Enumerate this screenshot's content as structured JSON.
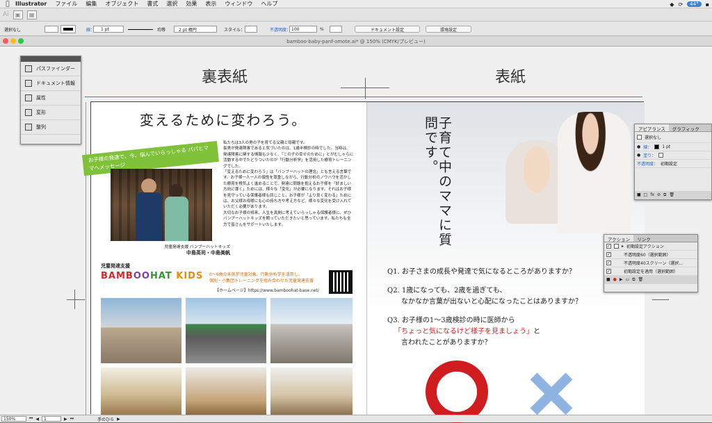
{
  "menubar": {
    "app": "Illustrator",
    "items": [
      "ファイル",
      "編集",
      "オブジェクト",
      "書式",
      "選択",
      "効果",
      "表示",
      "ウィンドウ",
      "ヘルプ"
    ],
    "battery": "44°"
  },
  "control": {
    "selection": "選択なし",
    "stroke_label": "線：",
    "stroke_width": "1 pt",
    "brush_label": "均等",
    "profile": "2 pt 楕円",
    "style_label": "スタイル：",
    "opacity_label": "不透明度：",
    "opacity": "100",
    "percent": "%",
    "doc_setup": "ドキュメント設定",
    "prefs": "環境設定"
  },
  "tab": {
    "title": "bamboo-baby-panf-omote.ai* @ 150% (CMYK/プレビュー)"
  },
  "toolpanel": {
    "items": [
      "パスファインダー",
      "ドキュメント情報",
      "属性",
      "変形",
      "整列"
    ]
  },
  "labels": {
    "back": "裏表紙",
    "front": "表紙"
  },
  "back": {
    "headline": "変えるために変わろう。",
    "ribbon": "お子様の発達で、今、悩んでいらっしゃる パパとママへメッセージ",
    "paragraphs": [
      "私たちは3人の男の子を育てる父親と母親です。",
      "長男が発達障害であると気づいたのは、1歳半検診の時でした。当時は、発達障害に関する情報も少なく、「この子の幸せのために」とがむしゃらに活動する中でたどりついたのが「行動分析学」を活用した療育トレーニングでした。",
      "「変えるために変わろう」は「バンブーハットの理念」とも言える言葉です。お子様一人一人の個性を尊重しながら、行動分析のノウハウを活かした療育を根気よく進めることで、発達に問題を抱えるお子様を「好ましい方向に導く」ためには、様々な「変化」が必要になります。それはお子様を見守っている保護者様も同じこと。お子様が「より良く変わる」ためには、お父様お母様にも心の持ち方や考え方など、様々な変化を受け入れていただく必要があります。",
      "大切なお子様の将来、人生を真剣に考えていらっしゃる保護者様に、ぜひバンブーハットキッズを頼っていただきたいと思っています。私たちも全力で皆さんをサポートいたします。"
    ],
    "caption_org": "児童発達支援 バンブーハットキッズ",
    "caption_names": "中島英司・中島美帆",
    "section": "児童発達支援",
    "logo": {
      "a": "BAMB",
      "b": "OO",
      "c": "HAT",
      "d": " KIDS"
    },
    "info1": "0～6歳の未就学児童対象。行動分析学を活用し、",
    "info2": "個別・小集団トレーニングを組み合わせた児童発達支援",
    "homepage": "【ホームページ】https://www.bamboohat-base.net/"
  },
  "front": {
    "title": "子育て中のママに質問です。",
    "q1": "Q1. お子さまの成長や発達で気になるところがありますか？",
    "q2a": "Q2. 1歳になっても、2歳を過ぎても、",
    "q2b": "なかなか言葉が出ないと心配になったことはありますか？",
    "q3a": "Q3. お子様の1～3歳検診の時に医師から",
    "q3b": "「ちょっと気になるけど様子を見ましょう」",
    "q3b2": "と",
    "q3c": "言われたことがありますか？"
  },
  "appearance": {
    "tabs": [
      "アピアランス",
      "グラフィック"
    ],
    "selection": "選択なし",
    "rows": [
      {
        "label": "線：",
        "value": "1 pt"
      },
      {
        "label": "塗り：",
        "value": ""
      },
      {
        "label": "不透明度：",
        "value": "初期設定"
      }
    ]
  },
  "actions": {
    "tabs": [
      "アクション",
      "リンク"
    ],
    "set": "初期設定アクション",
    "items": [
      "不透明度60（選択範囲）",
      "不透明度40スクリーン（選択...",
      "初期設定を適用（選択範囲）"
    ]
  },
  "status": {
    "zoom": "150%",
    "page": "1",
    "tool": "手のひら"
  }
}
